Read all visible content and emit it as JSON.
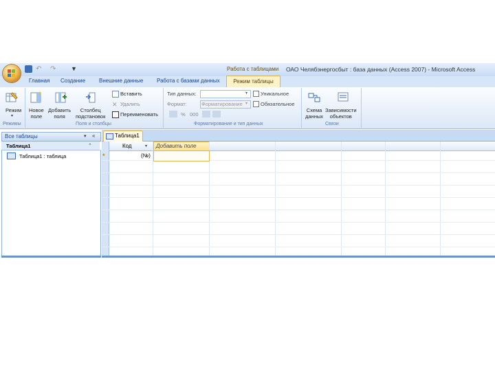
{
  "window": {
    "title": "ОАО Челябэнергосбыт : база данных (Access 2007) - Microsoft Access",
    "context_tab_label": "Работа с таблицами"
  },
  "quick_access": {
    "more_glyph": "▼"
  },
  "tabs": [
    {
      "label": "Главная"
    },
    {
      "label": "Создание"
    },
    {
      "label": "Внешние данные"
    },
    {
      "label": "Работа с базами данных"
    },
    {
      "label": "Режим таблицы",
      "active": true
    }
  ],
  "ribbon": {
    "groups": {
      "views": {
        "label": "Режимы",
        "view_button": "Режим"
      },
      "fields_columns": {
        "label": "Поля и столбцы",
        "new_field": "Новое\nполе",
        "add_existing": "Добавить\nполя",
        "lookup_column": "Столбец\nподстановок",
        "insert": "Вставить",
        "delete": "Удалить",
        "rename": "Переименовать"
      },
      "formatting": {
        "label": "Форматирование и тип данных",
        "data_type_label": "Тип данных:",
        "format_label": "Формат:",
        "format_value": "Форматирование",
        "unique": "Уникальное",
        "required": "Обязательное",
        "percent": "%",
        "thousands": "000"
      },
      "relationships": {
        "label": "Связи",
        "schema": "Схема\nданных",
        "dependencies": "Зависимости\nобъектов"
      }
    }
  },
  "nav_pane": {
    "title": "Все таблицы",
    "group": "Таблица1",
    "items": [
      {
        "label": "Таблица1 : таблица"
      }
    ]
  },
  "document": {
    "tab_label": "Таблица1",
    "columns": [
      "Код",
      "Добавить поле"
    ],
    "new_row_marker": "*",
    "new_row_kod": "(№)"
  },
  "colors": {
    "ribbon_bg": "#dbe7f7",
    "active_tab": "#fdf2c8",
    "accent": "#15428b"
  }
}
